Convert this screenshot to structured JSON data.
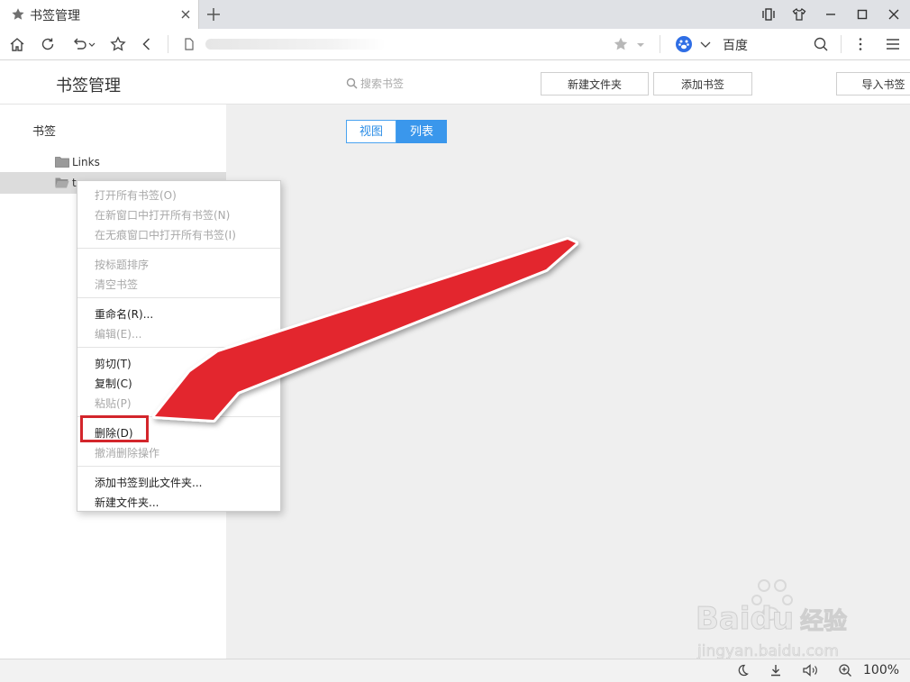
{
  "tab": {
    "title": "书签管理"
  },
  "address": {
    "search_engine": "百度"
  },
  "bookmark_manager": {
    "title": "书签管理",
    "search_placeholder": "搜索书签",
    "buttons": {
      "new_folder": "新建文件夹",
      "add_bookmark": "添加书签",
      "import": "导入书签"
    }
  },
  "sidebar": {
    "root": "书签",
    "items": [
      {
        "label": "Links"
      },
      {
        "label": "t"
      }
    ]
  },
  "view_toggle": {
    "view": "视图",
    "list": "列表"
  },
  "context_menu": {
    "open_all": "打开所有书签(O)",
    "open_all_new_window": "在新窗口中打开所有书签(N)",
    "open_all_incognito": "在无痕窗口中打开所有书签(I)",
    "sort_by_title": "按标题排序",
    "clear": "清空书签",
    "rename": "重命名(R)...",
    "edit": "编辑(E)...",
    "cut": "剪切(T)",
    "copy": "复制(C)",
    "paste": "粘贴(P)",
    "delete": "删除(D)",
    "undo_delete": "撤消删除操作",
    "add_to_folder": "添加书签到此文件夹...",
    "new_folder": "新建文件夹..."
  },
  "statusbar": {
    "zoom": "100%"
  },
  "watermark": {
    "brand": "Baidu",
    "suffix": "经验",
    "url": "jingyan.baidu.com"
  },
  "colors": {
    "accent": "#3a97ec",
    "annotation": "#e3262e"
  }
}
